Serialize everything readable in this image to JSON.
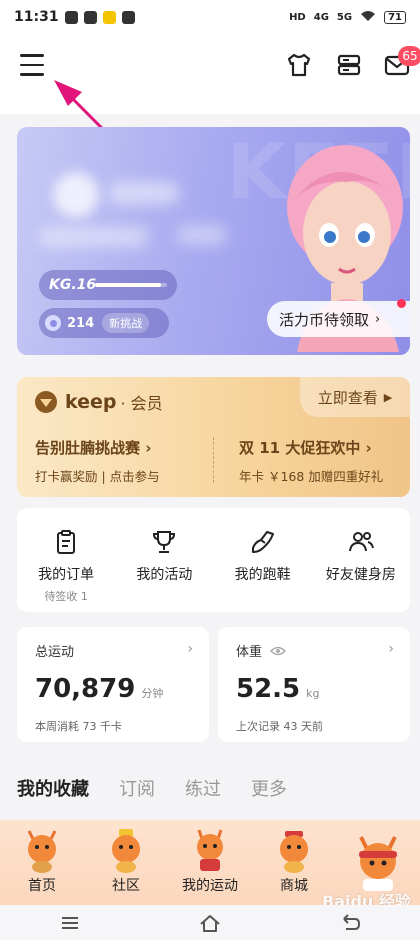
{
  "status_bar": {
    "time": "11:31",
    "network_5g": "5G",
    "network_4g": "4G",
    "battery": "71"
  },
  "header": {
    "mail_count": "65"
  },
  "profile": {
    "watermark": "KEEP",
    "level": "KG.16",
    "level_progress": 0.92,
    "coins": "214",
    "challenge_tag": "新挑战",
    "claim_label": "活力币待领取"
  },
  "membership": {
    "brand": "keep",
    "title": "· 会员",
    "view_label": "立即查看",
    "promos": [
      {
        "title": "告别肚腩挑战赛",
        "subtitle": "打卡赢奖励 | 点击参与"
      },
      {
        "title": "双 11 大促狂欢中",
        "subtitle": "年卡 ￥168 加赠四重好礼"
      }
    ]
  },
  "shortcuts": [
    {
      "label": "我的订单",
      "sub": "待签收 1"
    },
    {
      "label": "我的活动",
      "sub": ""
    },
    {
      "label": "我的跑鞋",
      "sub": ""
    },
    {
      "label": "好友健身房",
      "sub": ""
    }
  ],
  "stats": {
    "exercise": {
      "title": "总运动",
      "value": "70,879",
      "unit": "分钟",
      "sub": "本周消耗 73 千卡"
    },
    "weight": {
      "title": "体重",
      "value": "52.5",
      "unit": "kg",
      "sub": "上次记录 43 天前"
    }
  },
  "tabs": [
    "我的收藏",
    "订阅",
    "练过",
    "更多"
  ],
  "bottom_nav": [
    "首页",
    "社区",
    "我的运动",
    "商城",
    ""
  ],
  "baidu_watermark": "Baidu 经验",
  "colors": {
    "accent": "#ff4d63",
    "member_text": "#6b4519",
    "annotation_arrow": "#e0147a"
  }
}
